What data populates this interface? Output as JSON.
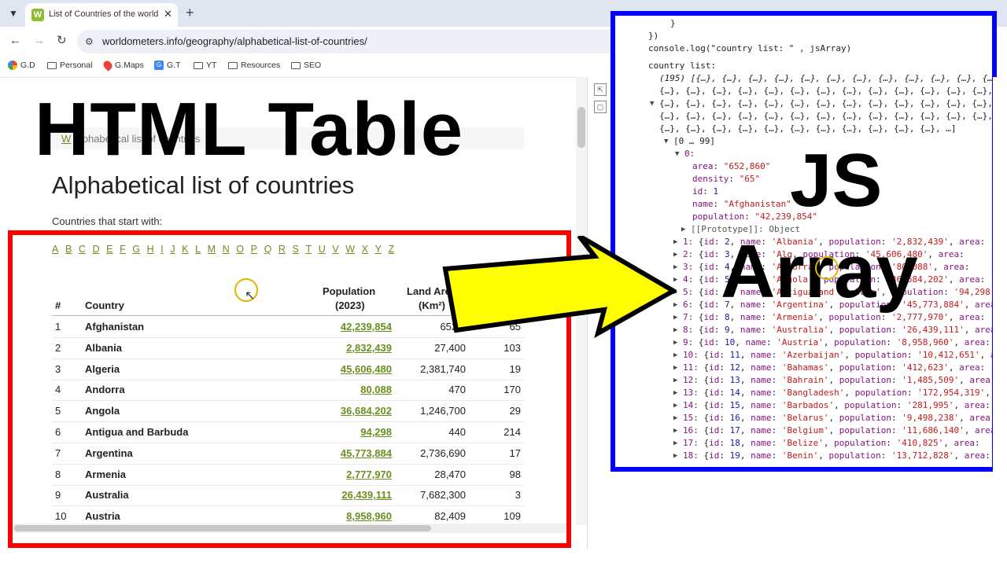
{
  "browser": {
    "tab_title": "List of Countries of the world in",
    "url": "worldometers.info/geography/alphabetical-list-of-countries/",
    "bookmarks": [
      "G.D",
      "Personal",
      "G.Maps",
      "G.T",
      "YT",
      "Resources",
      "SEO"
    ]
  },
  "overlay": {
    "left_title": "HTML Table",
    "right_title_1": "JS",
    "right_title_2": "Array"
  },
  "page": {
    "breadcrumb_home": "W",
    "breadcrumb_text": "Alphabetical list of countries",
    "title": "Alphabetical list of countries",
    "intro": "Countries that start with:",
    "letters": [
      "A",
      "B",
      "C",
      "D",
      "E",
      "F",
      "G",
      "H",
      "I",
      "J",
      "K",
      "L",
      "M",
      "N",
      "O",
      "P",
      "Q",
      "R",
      "S",
      "T",
      "U",
      "V",
      "W",
      "X",
      "Y",
      "Z"
    ],
    "columns": {
      "num": "#",
      "country": "Country",
      "population_1": "Population",
      "population_2": "(2023)",
      "area_1": "Land Area",
      "area_2": "(Km²)"
    },
    "rows": [
      {
        "num": "1",
        "name": "Afghanistan",
        "pop": "42,239,854",
        "area": "652,8",
        "den": "65"
      },
      {
        "num": "2",
        "name": "Albania",
        "pop": "2,832,439",
        "area": "27,400",
        "den": "103"
      },
      {
        "num": "3",
        "name": "Algeria",
        "pop": "45,606,480",
        "area": "2,381,740",
        "den": "19"
      },
      {
        "num": "4",
        "name": "Andorra",
        "pop": "80,088",
        "area": "470",
        "den": "170"
      },
      {
        "num": "5",
        "name": "Angola",
        "pop": "36,684,202",
        "area": "1,246,700",
        "den": "29"
      },
      {
        "num": "6",
        "name": "Antigua and Barbuda",
        "pop": "94,298",
        "area": "440",
        "den": "214"
      },
      {
        "num": "7",
        "name": "Argentina",
        "pop": "45,773,884",
        "area": "2,736,690",
        "den": "17"
      },
      {
        "num": "8",
        "name": "Armenia",
        "pop": "2,777,970",
        "area": "28,470",
        "den": "98"
      },
      {
        "num": "9",
        "name": "Australia",
        "pop": "26,439,111",
        "area": "7,682,300",
        "den": "3"
      },
      {
        "num": "10",
        "name": "Austria",
        "pop": "8,958,960",
        "area": "82,409",
        "den": "109"
      }
    ]
  },
  "console": {
    "line_brace": "}",
    "line_close": "})",
    "line_log": "console.log(\"country list: \" , jsArray)",
    "log_label": "country list:",
    "array_head": "(195) [{…}, {…}, {…}, {…}, {…}, {…}, {…}, {…}, {…}, {…}, {…}, {…},",
    "array_fill": "{…}, {…}, {…}, {…}, {…}, {…}, {…}, {…}, {…}, {…}, {…}, {…}, {…},",
    "array_tail": "{…}, {…}, {…}, {…}, {…}, {…}, {…}, {…}, {…}, {…}, {…}, …]",
    "range": "[0 … 99]",
    "index0": "0:",
    "fields": [
      {
        "k": "area",
        "v": "\"652,860\"",
        "t": "str"
      },
      {
        "k": "density",
        "v": "\"65\"",
        "t": "str"
      },
      {
        "k": "id",
        "v": "1",
        "t": "num"
      },
      {
        "k": "name",
        "v": "\"Afghanistan\"",
        "t": "str"
      },
      {
        "k": "population",
        "v": "\"42,239,854\"",
        "t": "str"
      }
    ],
    "proto": "[[Prototype]]: Object",
    "items": [
      {
        "i": "1:",
        "id": "2",
        "name": "'Albania'",
        "pop": "'2,832,439'"
      },
      {
        "i": "2:",
        "id": "3",
        "name": "'Alg",
        "pop": "'45,606,480'"
      },
      {
        "i": "3:",
        "id": "4",
        "name": "'Andorra'",
        "pop": "'80,088'"
      },
      {
        "i": "4:",
        "id": "5",
        "name": "'Angola'",
        "pop": "'36,684,202'"
      },
      {
        "i": "5:",
        "id": "6",
        "name": "'Antigua and Barbuda'",
        "pop": "'94,298'"
      },
      {
        "i": "6:",
        "id": "7",
        "name": "'Argentina'",
        "pop": "'45,773,884'"
      },
      {
        "i": "7:",
        "id": "8",
        "name": "'Armenia'",
        "pop": "'2,777,970'"
      },
      {
        "i": "8:",
        "id": "9",
        "name": "'Australia'",
        "pop": "'26,439,111'"
      },
      {
        "i": "9:",
        "id": "10",
        "name": "'Austria'",
        "pop": "'8,958,960'"
      },
      {
        "i": "10:",
        "id": "11",
        "name": "'Azerbaijan'",
        "pop": "'10,412,651'"
      },
      {
        "i": "11:",
        "id": "12",
        "name": "'Bahamas'",
        "pop": "'412,623'"
      },
      {
        "i": "12:",
        "id": "13",
        "name": "'Bahrain'",
        "pop": "'1,485,509'"
      },
      {
        "i": "13:",
        "id": "14",
        "name": "'Bangladesh'",
        "pop": "'172,954,319'"
      },
      {
        "i": "14:",
        "id": "15",
        "name": "'Barbados'",
        "pop": "'281,995'"
      },
      {
        "i": "15:",
        "id": "16",
        "name": "'Belarus'",
        "pop": "'9,498,238'"
      },
      {
        "i": "16:",
        "id": "17",
        "name": "'Belgium'",
        "pop": "'11,686,140'"
      },
      {
        "i": "17:",
        "id": "18",
        "name": "'Belize'",
        "pop": "'410,825'"
      },
      {
        "i": "18:",
        "id": "19",
        "name": "'Benin'",
        "pop": "'13,712,828'"
      }
    ]
  },
  "colors": {
    "red_frame": "#ff0000",
    "blue_frame": "#0000ff",
    "arrow_fill": "#ffff00",
    "link_green": "#6a8f1e"
  }
}
